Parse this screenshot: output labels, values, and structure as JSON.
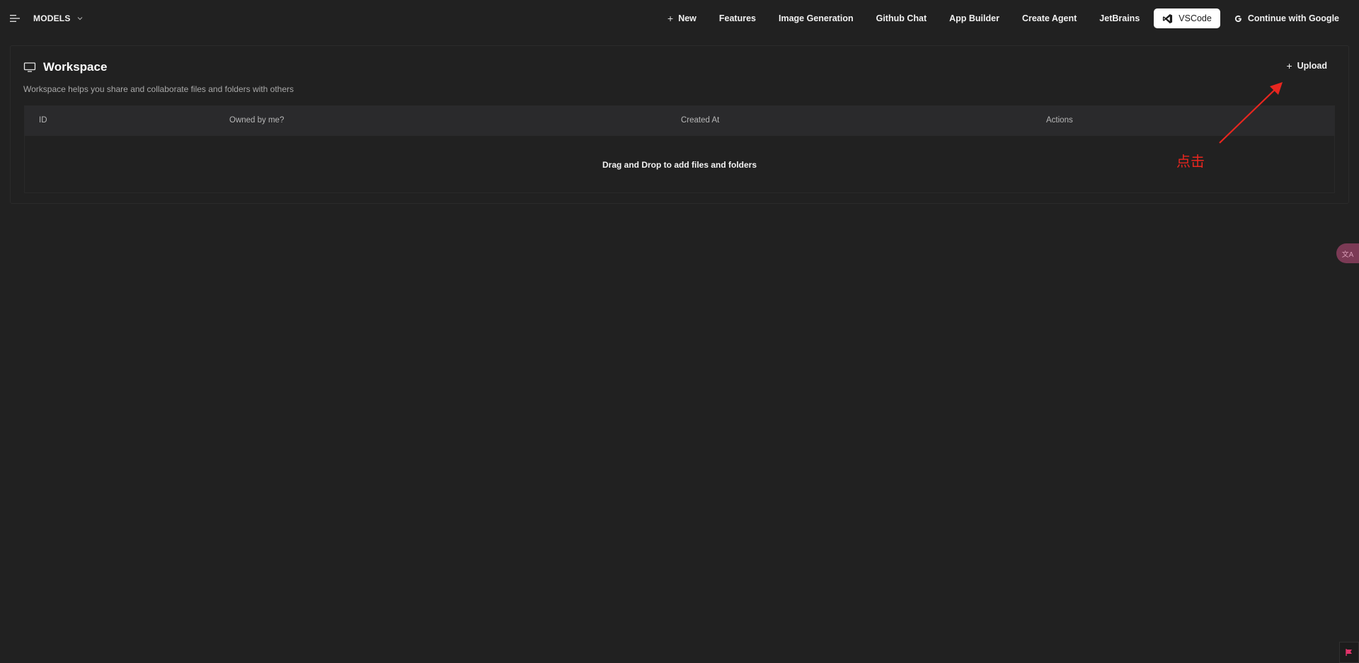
{
  "topbar": {
    "models_label": "MODELS",
    "nav": {
      "new": "New",
      "features": "Features",
      "image_generation": "Image Generation",
      "github_chat": "Github Chat",
      "app_builder": "App Builder",
      "create_agent": "Create Agent",
      "jetbrains": "JetBrains",
      "vscode": "VSCode",
      "google": "Continue with Google"
    }
  },
  "workspace": {
    "title": "Workspace",
    "description": "Workspace helps you share and collaborate files and folders with others",
    "upload_label": "Upload",
    "table": {
      "columns": [
        "ID",
        "Owned by me?",
        "Created At",
        "Actions"
      ],
      "empty_message": "Drag and Drop to add files and folders"
    }
  },
  "annotation": {
    "text": "点击",
    "color": "#e8261f"
  },
  "floating": {
    "translate_label": "文A"
  },
  "colors": {
    "background": "#212121",
    "header_row": "#2a2a2c",
    "accent_annotation": "#e8261f"
  }
}
